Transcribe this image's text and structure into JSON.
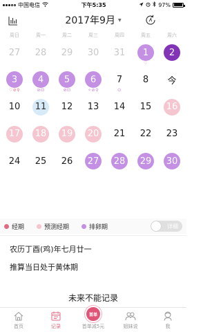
{
  "status": {
    "carrier": "中国电信",
    "time": "下午5:35",
    "battery": "97%",
    "battery_level": 0.97
  },
  "header": {
    "title": "2017年9月"
  },
  "weekdays": [
    "周日",
    "周一",
    "周二",
    "周三",
    "周四",
    "周五",
    "周六"
  ],
  "days": [
    {
      "label": "27",
      "style": "dim",
      "marks": ""
    },
    {
      "label": "28",
      "style": "dim",
      "marks": ""
    },
    {
      "label": "29",
      "style": "dim",
      "marks": ""
    },
    {
      "label": "30",
      "style": "dim",
      "marks": ""
    },
    {
      "label": "31",
      "style": "dim",
      "marks": ""
    },
    {
      "label": "1",
      "style": "fertile",
      "marks": "♡"
    },
    {
      "label": "2",
      "style": "ovulation",
      "marks": ""
    },
    {
      "label": "3",
      "style": "fertile",
      "marks": "♡⊘⚲"
    },
    {
      "label": "4",
      "style": "fertile",
      "marks": "⊘⊡"
    },
    {
      "label": "5",
      "style": "fertile",
      "marks": "⊘⊡"
    },
    {
      "label": "6",
      "style": "fertile",
      "marks": "✧⊘⚲"
    },
    {
      "label": "7",
      "style": "plain",
      "marks": "⏻"
    },
    {
      "label": "8",
      "style": "plain",
      "marks": ""
    },
    {
      "label": "今",
      "style": "plain",
      "marks": ""
    },
    {
      "label": "10",
      "style": "plain",
      "marks": ""
    },
    {
      "label": "11",
      "style": "today",
      "marks": ""
    },
    {
      "label": "12",
      "style": "plain",
      "marks": ""
    },
    {
      "label": "13",
      "style": "plain",
      "marks": ""
    },
    {
      "label": "14",
      "style": "plain",
      "marks": ""
    },
    {
      "label": "15",
      "style": "plain",
      "marks": ""
    },
    {
      "label": "16",
      "style": "period",
      "marks": ""
    },
    {
      "label": "17",
      "style": "period",
      "marks": ""
    },
    {
      "label": "18",
      "style": "period",
      "marks": ""
    },
    {
      "label": "19",
      "style": "period",
      "marks": ""
    },
    {
      "label": "20",
      "style": "period",
      "marks": ""
    },
    {
      "label": "21",
      "style": "plain",
      "marks": ""
    },
    {
      "label": "22",
      "style": "plain",
      "marks": ""
    },
    {
      "label": "23",
      "style": "plain",
      "marks": ""
    },
    {
      "label": "24",
      "style": "plain",
      "marks": ""
    },
    {
      "label": "25",
      "style": "plain",
      "marks": ""
    },
    {
      "label": "26",
      "style": "plain",
      "marks": ""
    },
    {
      "label": "27",
      "style": "fertile",
      "marks": ""
    },
    {
      "label": "28",
      "style": "fertile",
      "marks": ""
    },
    {
      "label": "29",
      "style": "fertile",
      "marks": ""
    },
    {
      "label": "30",
      "style": "fertile",
      "marks": ""
    }
  ],
  "legend": {
    "items": [
      {
        "label": "经期",
        "color": "#e06b83"
      },
      {
        "label": "预测经期",
        "color": "#f5c6cf"
      },
      {
        "label": "排卵期",
        "color": "#c490e4"
      }
    ],
    "toggle_label": "详细"
  },
  "info": {
    "lunar": "农历丁酉(鸡)年七月廿一",
    "auspicious": "推算当日处于黄体期"
  },
  "cta": "未来不能记录",
  "tabs": [
    {
      "label": "首页",
      "icon": "home-icon",
      "active": false
    },
    {
      "label": "记录",
      "icon": "calendar-icon",
      "active": true
    },
    {
      "label": "首单减5元",
      "icon": "promo-icon",
      "active": false
    },
    {
      "label": "姐妹说",
      "icon": "community-icon",
      "active": false
    },
    {
      "label": "我",
      "icon": "profile-icon",
      "active": false
    }
  ],
  "promo_badge": "首单"
}
